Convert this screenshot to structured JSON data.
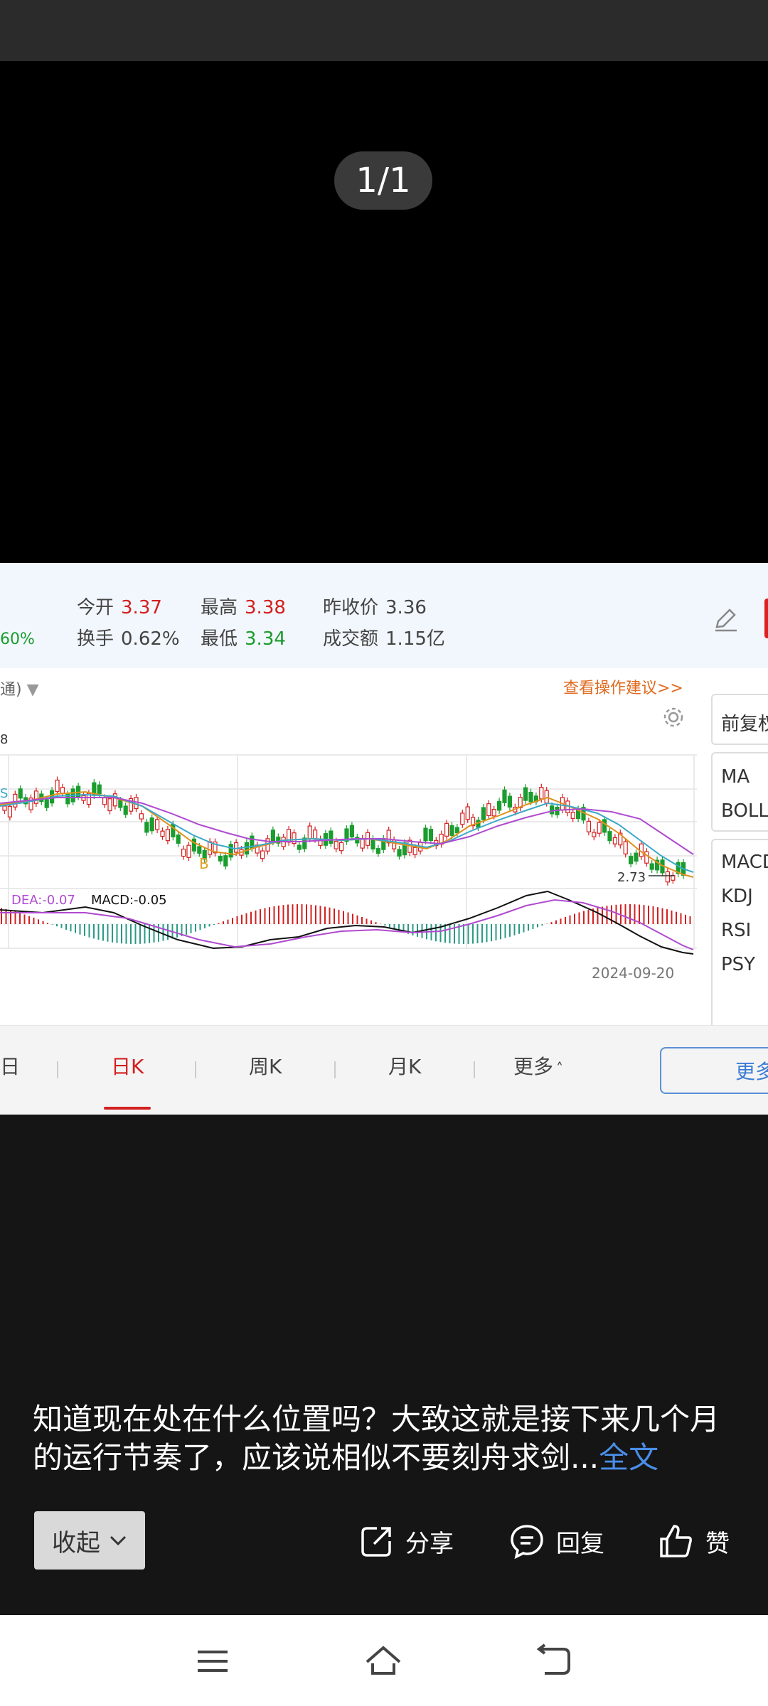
{
  "viewer": {
    "counter": "1/1"
  },
  "quote": {
    "open_label": "今开",
    "open_value": "3.37",
    "high_label": "最高",
    "high_value": "3.38",
    "prev_close_label": "昨收价",
    "prev_close_value": "3.36",
    "turnover_label": "换手",
    "turnover_value": "0.62%",
    "low_label": "最低",
    "low_value": "3.34",
    "amount_label": "成交额",
    "amount_value": "1.15亿",
    "change_pct_partial": "60%"
  },
  "toolbar": {
    "chart_type_partial": "通)",
    "advice_link": "查看操作建议>>"
  },
  "chart": {
    "top_value_partial": "8",
    "buy_marker": "B",
    "sell_marker_partial": "S",
    "low_label": "2.73",
    "dea_label": "DEA:-0.07",
    "macd_label": "MACD:-0.05",
    "date_label": "2024-09-20"
  },
  "kline_tabs": [
    {
      "label": "日",
      "active": false
    },
    {
      "label": "日K",
      "active": true
    },
    {
      "label": "周K",
      "active": false
    },
    {
      "label": "月K",
      "active": false
    },
    {
      "label": "更多",
      "active": false
    }
  ],
  "more_button": "更多",
  "side_panel": {
    "adjust_partial": "前复权",
    "overlay_items": [
      "MA",
      "BOLL"
    ],
    "indicator_items": [
      "MACD",
      "KDJ",
      "RSI",
      "PSY"
    ]
  },
  "caption": {
    "text": "知道现在处在什么位置吗？大致这就是接下来几个月的运行节奏了，应该说相似不要刻舟求剑...",
    "full_link": "全文"
  },
  "actions": {
    "collapse": "收起",
    "share": "分享",
    "reply": "回复",
    "like": "赞"
  },
  "colors": {
    "up": "#d32020",
    "down": "#1a9c2e",
    "ma_fast": "#e0901e",
    "ma_mid": "#3aa8c8",
    "ma_slow": "#b04ad0",
    "link": "#4a8ee8"
  }
}
